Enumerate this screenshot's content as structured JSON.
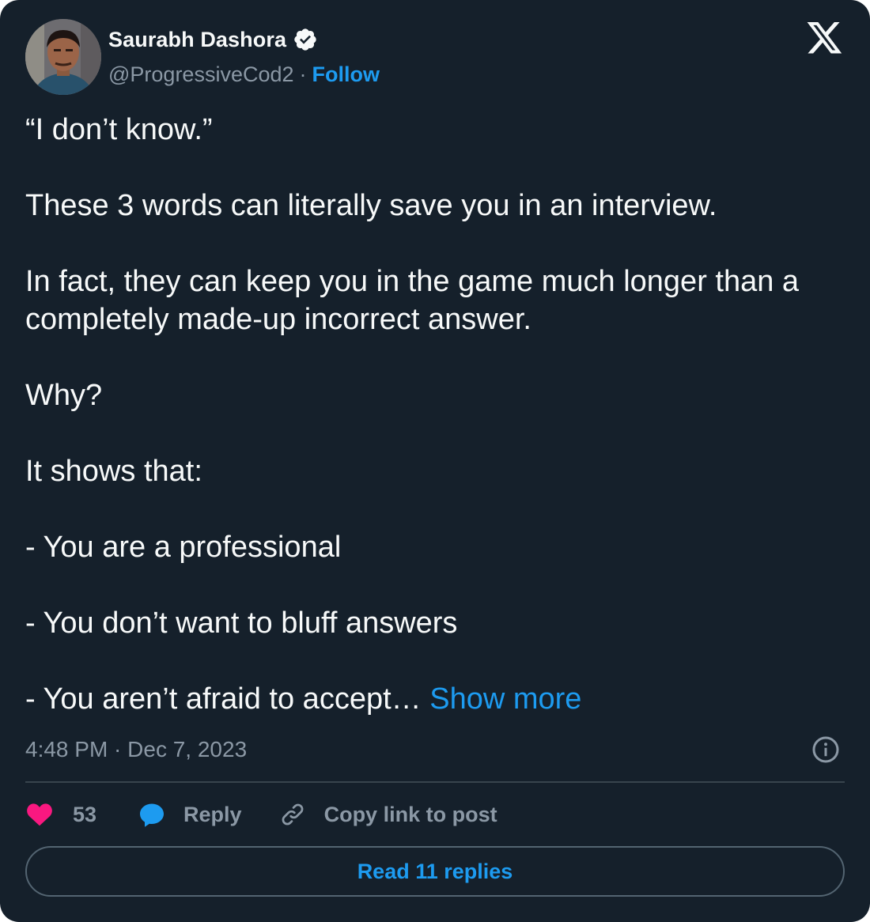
{
  "author": {
    "name": "Saurabh Dashora",
    "handle": "@ProgressiveCod2",
    "separator": "·",
    "follow_label": "Follow"
  },
  "tweet": {
    "lines": [
      "“I don’t know.”",
      "These 3 words can literally save you in an interview.",
      "In fact, they can keep you in the game much longer than a completely made-up incorrect answer.",
      "Why?",
      "It shows that:",
      "- You are a professional",
      "- You don’t want to bluff answers"
    ],
    "last_line": "- You aren’t afraid to accept…",
    "show_more_label": "Show more",
    "timestamp": "4:48 PM · Dec 7, 2023"
  },
  "actions": {
    "like_count": "53",
    "reply_label": "Reply",
    "copy_link_label": "Copy link to post",
    "read_replies_label": "Read 11 replies"
  },
  "colors": {
    "background": "#15202b",
    "accent": "#1d9bf0",
    "like": "#f91880",
    "muted": "#8b98a5"
  },
  "icons": [
    "verified-badge-icon",
    "x-logo-icon",
    "info-icon",
    "heart-icon",
    "reply-bubble-icon",
    "link-icon"
  ]
}
